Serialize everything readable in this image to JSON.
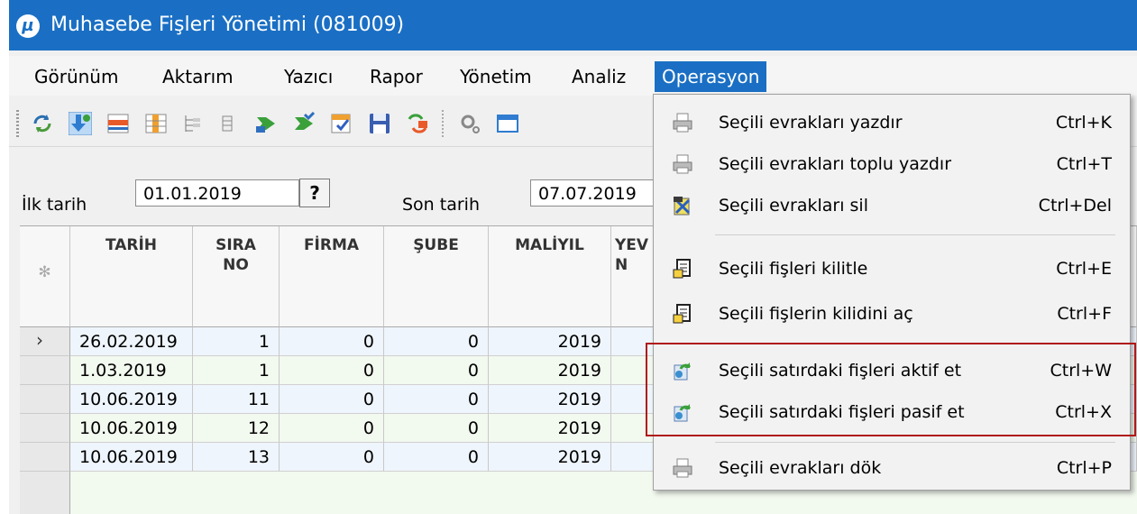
{
  "window": {
    "title": "Muhasebe Fişleri Yönetimi (081009)",
    "app_icon_glyph": "µ",
    "accent": "#1a6fc4"
  },
  "menubar": {
    "items": [
      {
        "label": "Görünüm"
      },
      {
        "label": "Aktarım"
      },
      {
        "label": "Yazıcı"
      },
      {
        "label": "Rapor"
      },
      {
        "label": "Yönetim"
      },
      {
        "label": "Analiz"
      },
      {
        "label": "Operasyon",
        "active": true
      }
    ]
  },
  "toolbar": {
    "buttons": [
      "refresh-icon",
      "add-down-icon",
      "band-icon",
      "columns-icon",
      "tree-icon",
      "tree-collapse-icon",
      "forward-green-icon",
      "forward-check-icon",
      "grid-check-icon",
      "save-icon",
      "transfer-icon",
      "settings-icon",
      "window-icon"
    ]
  },
  "filters": {
    "start_label": "İlk tarih",
    "start_value": "01.01.2019",
    "question": "?",
    "end_label": "Son tarih",
    "end_value": "07.07.2019"
  },
  "grid": {
    "corner_glyph": "✻",
    "columns": [
      {
        "label": "TARİH"
      },
      {
        "label": "SIRA\nNO"
      },
      {
        "label": "FİRMA"
      },
      {
        "label": "ŞUBE"
      },
      {
        "label": "MALİYIL"
      },
      {
        "label": "YEV\nN"
      }
    ],
    "rows": [
      {
        "current": true,
        "cells": [
          "26.02.2019",
          "1",
          "0",
          "0",
          "2019"
        ]
      },
      {
        "cells": [
          "1.03.2019",
          "1",
          "0",
          "0",
          "2019"
        ]
      },
      {
        "cells": [
          "10.06.2019",
          "11",
          "0",
          "0",
          "2019"
        ]
      },
      {
        "cells": [
          "10.06.2019",
          "12",
          "0",
          "0",
          "2019"
        ]
      },
      {
        "cells": [
          "10.06.2019",
          "13",
          "0",
          "0",
          "2019"
        ]
      }
    ]
  },
  "operasyon_menu": {
    "items": [
      {
        "label": "Seçili evrakları yazdır",
        "shortcut": "Ctrl+K",
        "icon": "printer-icon"
      },
      {
        "label": "Seçili evrakları toplu yazdır",
        "shortcut": "Ctrl+T",
        "icon": "printer-icon"
      },
      {
        "label": "Seçili evrakları sil",
        "shortcut": "Ctrl+Del",
        "icon": "delete-icon"
      },
      {
        "label": "Seçili fişleri kilitle",
        "shortcut": "Ctrl+E",
        "icon": "lock-document-icon"
      },
      {
        "label": "Seçili fişlerin kilidini aç",
        "shortcut": "Ctrl+F",
        "icon": "unlock-document-icon"
      },
      {
        "label": "Seçili satırdaki fişleri aktif et",
        "shortcut": "Ctrl+W",
        "icon": "activate-icon"
      },
      {
        "label": "Seçili satırdaki fişleri pasif et",
        "shortcut": "Ctrl+X",
        "icon": "deactivate-icon"
      },
      {
        "label": "Seçili evrakları dök",
        "shortcut": "Ctrl+P",
        "icon": "printer-icon"
      }
    ],
    "highlight_color": "#b01818"
  }
}
